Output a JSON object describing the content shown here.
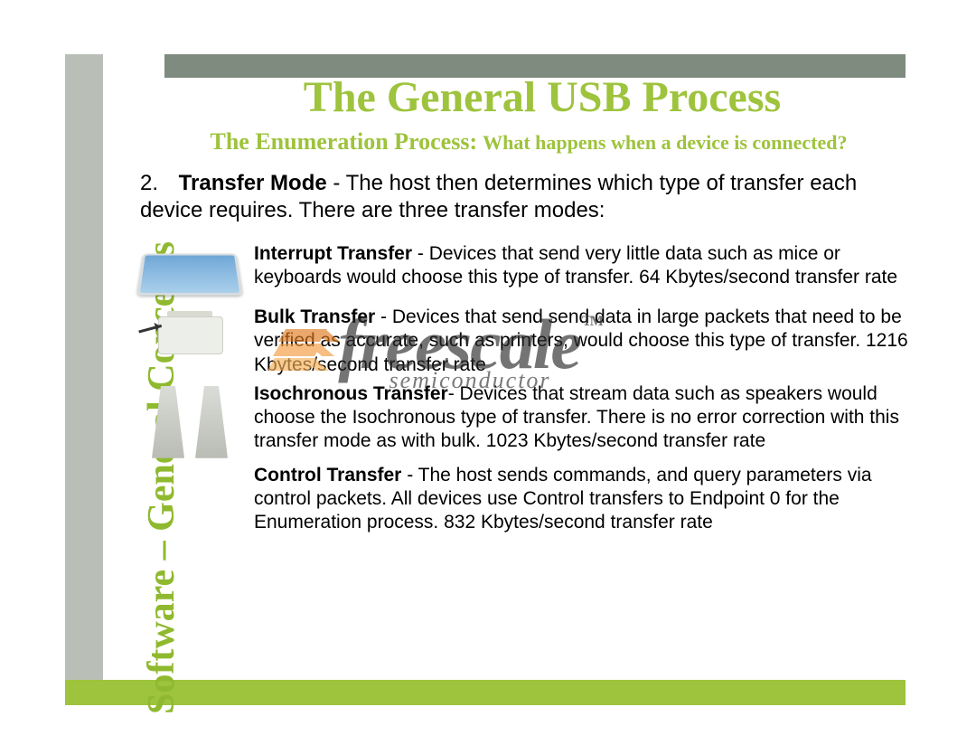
{
  "section_title": "Software – General Concepts",
  "title": "The General USB Process",
  "subtitle_strong": "The Enumeration Process:",
  "subtitle_rest": "What happens when a device is connected?",
  "intro_number": "2.",
  "intro_bold": "Transfer Mode",
  "intro_rest": " - The host then determines which type of transfer each device requires. There are three transfer modes:",
  "rows": [
    {
      "bold": "Interrupt Transfer",
      "rest": " -  Devices that send very little data such as mice or keyboards would choose this type of transfer. 64 Kbytes/second transfer rate"
    },
    {
      "bold": "Bulk Transfer",
      "rest": " - Devices that send send data in large packets that need to be verified as accurate, such as printers, would choose this type of transfer. 1216 Kbytes/second transfer rate"
    },
    {
      "bold": "Isochronous Transfer",
      "rest": "- Devices that stream data such as speakers would choose the Isochronous type of transfer. There is no error correction with this transfer mode as with bulk. 1023 Kbytes/second transfer rate"
    },
    {
      "bold": "Control Transfer",
      "rest": " - The host sends commands, and query parameters via control packets. All devices use Control transfers to Endpoint 0 for the Enumeration process. 832 Kbytes/second transfer rate"
    }
  ],
  "watermark_name": "freescale",
  "watermark_tm": "TM",
  "watermark_sub": "semiconductor"
}
